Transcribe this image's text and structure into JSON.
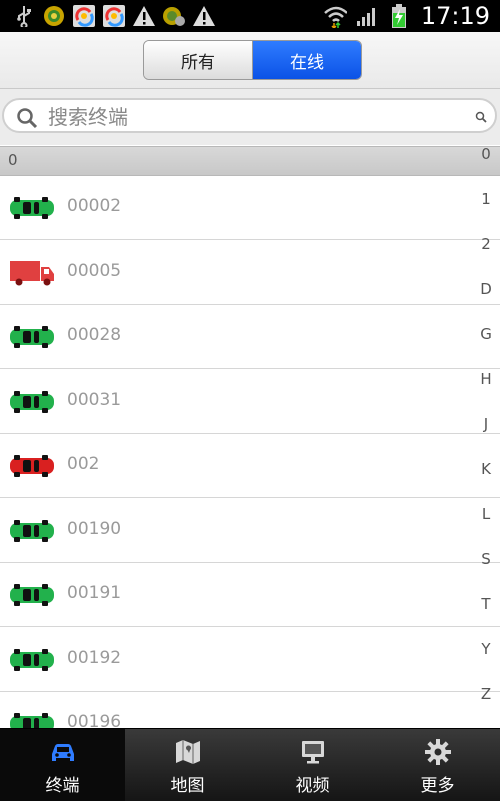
{
  "status_bar": {
    "time": "17:19",
    "icons": [
      "usb-icon",
      "app-notification-icon",
      "photos-icon",
      "photos-icon",
      "warning-icon",
      "app-notification-icon",
      "warning-icon",
      "wifi-icon",
      "signal-icon",
      "battery-icon"
    ]
  },
  "segment": {
    "all_label": "所有",
    "online_label": "在线",
    "selected": "online"
  },
  "search": {
    "placeholder": "搜索终端",
    "value": ""
  },
  "list": {
    "section_header": "0",
    "items": [
      {
        "label": "00002",
        "icon": "car-green-icon",
        "color": "#22b14c"
      },
      {
        "label": "00005",
        "icon": "truck-red-icon",
        "color": "#e04040"
      },
      {
        "label": "00028",
        "icon": "car-green-icon",
        "color": "#22b14c"
      },
      {
        "label": "00031",
        "icon": "car-green-icon",
        "color": "#22b14c"
      },
      {
        "label": "002",
        "icon": "car-red-icon",
        "color": "#d92020"
      },
      {
        "label": "00190",
        "icon": "car-green-icon",
        "color": "#22b14c"
      },
      {
        "label": "00191",
        "icon": "car-green-icon",
        "color": "#22b14c"
      },
      {
        "label": "00192",
        "icon": "car-green-icon",
        "color": "#22b14c"
      },
      {
        "label": "00196",
        "icon": "car-green-icon",
        "color": "#22b14c"
      }
    ]
  },
  "index_bar": [
    "0",
    "1",
    "2",
    "D",
    "G",
    "H",
    "J",
    "K",
    "L",
    "S",
    "T",
    "Y",
    "Z"
  ],
  "bottom_nav": {
    "items": [
      {
        "label": "终端",
        "icon": "car-icon",
        "active": true
      },
      {
        "label": "地图",
        "icon": "map-icon",
        "active": false
      },
      {
        "label": "视频",
        "icon": "monitor-icon",
        "active": false
      },
      {
        "label": "更多",
        "icon": "gear-icon",
        "active": false
      }
    ]
  },
  "colors": {
    "accent": "#0b52e6",
    "nav_active_icon": "#2f7cff"
  }
}
